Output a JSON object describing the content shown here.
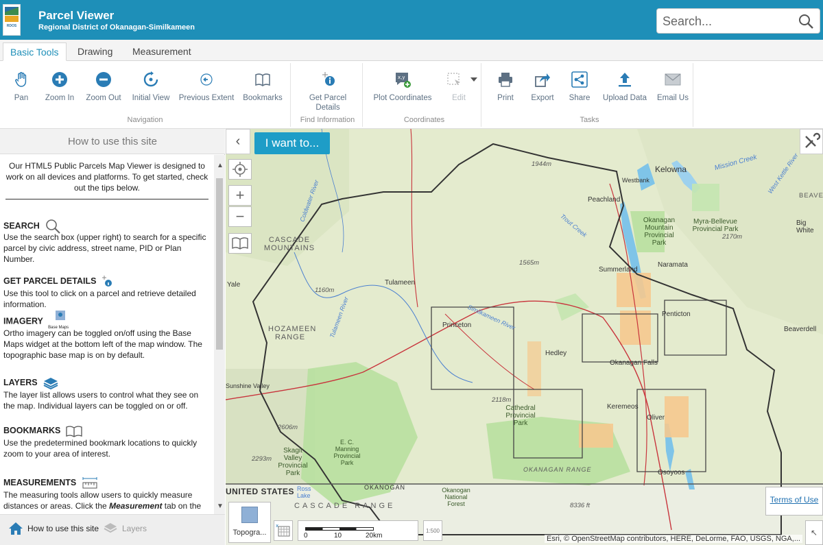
{
  "header": {
    "title": "Parcel Viewer",
    "subtitle": "Regional District of Okanagan-Similkameen",
    "logo_text": "RDOS",
    "search_placeholder": "Search..."
  },
  "tabs": [
    {
      "label": "Basic Tools",
      "active": true
    },
    {
      "label": "Drawing",
      "active": false
    },
    {
      "label": "Measurement",
      "active": false
    }
  ],
  "toolbar": {
    "groups": [
      {
        "label": "Navigation",
        "tools": [
          "Pan",
          "Zoom In",
          "Zoom Out",
          "Initial View",
          "Previous Extent",
          "Bookmarks"
        ]
      },
      {
        "label": "Find Information",
        "tools": [
          "Get Parcel Details"
        ]
      },
      {
        "label": "Coordinates",
        "tools": [
          "Plot Coordinates",
          "Edit"
        ]
      },
      {
        "label": "Tasks",
        "tools": [
          "Print",
          "Export",
          "Share",
          "Upload Data",
          "Email Us"
        ]
      }
    ]
  },
  "panel": {
    "heading": "How to use this site",
    "intro": "Our HTML5 Public Parcels Map Viewer is designed to work on all devices and platforms. To get started, check out the tips below.",
    "sections": [
      {
        "title": "SEARCH",
        "text": "Use the search box (upper right) to search for a specific parcel by civic address, street name, PID or Plan Number."
      },
      {
        "title": "GET PARCEL DETAILS",
        "text": "Use this tool to click on a parcel and retrieve detailed information."
      },
      {
        "title": "IMAGERY",
        "icon_label": "Base Maps",
        "text": "Ortho imagery can be toggled on/off using the Base Maps widget at the bottom left of the map window. The topographic base map is on by default."
      },
      {
        "title": "LAYERS",
        "text": "The layer list allows users to control what they see on the map.  Individual layers can be toggled on or off."
      },
      {
        "title": "BOOKMARKS",
        "text": "Use the predetermined bookmark locations to quickly zoom to your area of interest."
      },
      {
        "title": "MEASUREMENTS",
        "text_before": "The measuring tools allow users to quickly measure distances or areas. Click the ",
        "text_emph": "Measurement",
        "text_after": " tab on the"
      }
    ],
    "footer_tabs": [
      {
        "label": "How to use this site",
        "active": true
      },
      {
        "label": "Layers",
        "active": false
      }
    ]
  },
  "map": {
    "i_want_to": "I want to...",
    "basemap_label": "Topogra...",
    "scale": {
      "ticks": [
        "0",
        "10",
        "20km"
      ]
    },
    "scale_ratio_label": "1:500",
    "attribution": "Esri, © OpenStreetMap contributors, HERE, DeLorme, FAO, USGS, NGA,...",
    "terms_label": "Terms of Use",
    "labels": {
      "kelowna": "Kelowna",
      "mission_creek": "Mission Creek",
      "westbank": "Westbank",
      "peachland": "Peachland",
      "summerland": "Summerland",
      "naramata": "Naramata",
      "penticton": "Penticton",
      "okanagan_falls": "Okanagan Falls",
      "keremeos": "Keremeos",
      "oliver": "Oliver",
      "osoyoos": "Osoyoos",
      "princeton": "Princeton",
      "tulameen": "Tulameen",
      "hedley": "Hedley",
      "yale": "Yale",
      "beaverdell": "Beaverdell",
      "big_white": "Big White",
      "cascade_mountains": "CASCADE MOUNTAINS",
      "hozameen_range": "HOZAMEEN RANGE",
      "cascade_range": "CASCADE RANGE",
      "united_states": "UNITED STATES",
      "okanogan": "OKANOGAN",
      "okanagan_range": "OKANAGAN RANGE",
      "beaver_range": "BEAVER RANG",
      "west_kettle": "West Kettle River",
      "cathedral": "Cathedral Provincial Park",
      "okanagan_mountain": "Okanagan Mountain Provincial Park",
      "myra_bellevue": "Myra-Bellevue Provincial Park",
      "skagit": "Skagit Valley Provincial Park",
      "manning": "E. C. Manning Provincial Park",
      "okanogan_forest": "Okanogan National Forest",
      "ross_lake": "Ross Lake",
      "sunshine_valley": "Sunshine Valley",
      "trout_creek": "Trout Creek",
      "coldwater": "Coldwater River",
      "tulameen_river": "Tulameen River",
      "similkameen_river": "Similkameen River",
      "e1944": "1944m",
      "e2170": "2170m",
      "e1565": "1565m",
      "e1160": "1160m",
      "e2118": "2118m",
      "e2606": "2606m",
      "e2293": "2293m",
      "e8336": "8336 ft"
    }
  },
  "colors": {
    "header_bg": "#1e8fb8",
    "accent": "#1e9dc7",
    "water": "#7fc4e8",
    "park": "#b8e0a0",
    "boundary": "#333333",
    "parcel": "#f5c98f"
  }
}
